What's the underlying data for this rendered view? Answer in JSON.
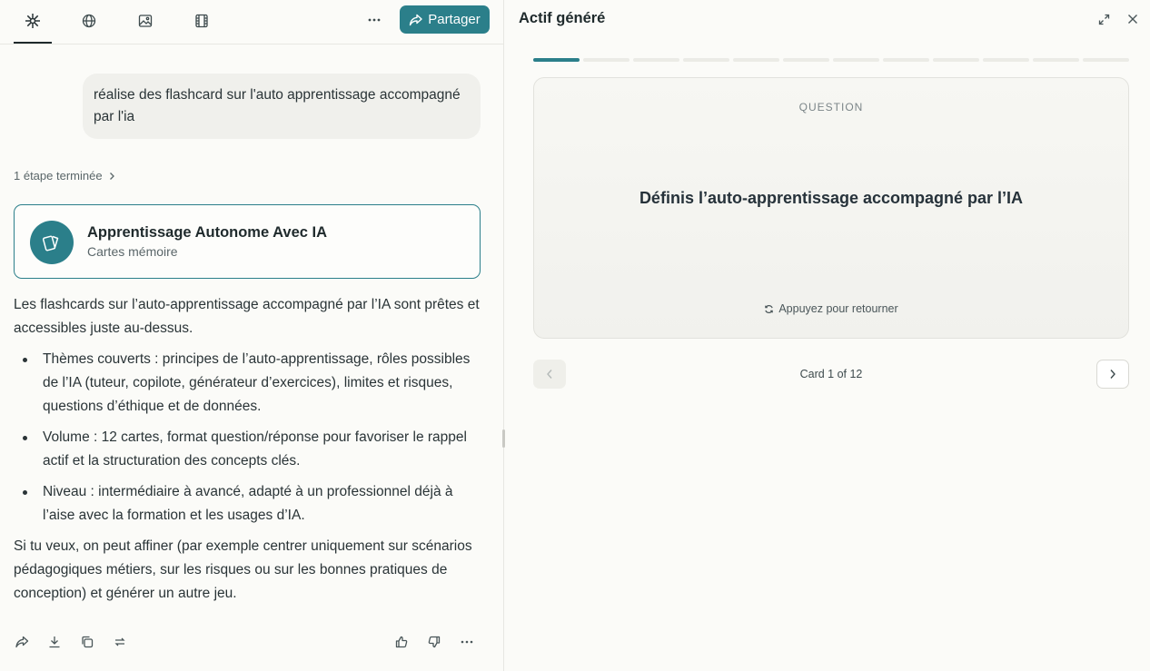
{
  "left_panel": {
    "tabs": [
      {
        "icon": "sparkle-icon",
        "active": true
      },
      {
        "icon": "globe-icon"
      },
      {
        "icon": "image-icon"
      },
      {
        "icon": "film-icon"
      }
    ],
    "share_label": "Partager",
    "user_message": "réalise des flashcard sur l'auto apprentissage accompagné par l'ia",
    "steps_label": "1 étape terminée",
    "asset": {
      "title": "Apprentissage Autonome Avec IA",
      "subtitle": "Cartes mémoire",
      "icon": "cards-icon"
    },
    "answer": {
      "intro": "Les flashcards sur l’auto-apprentissage accompagné par l’IA sont prêtes et accessibles juste au-dessus.",
      "bullets": [
        "Thèmes couverts : principes de l’auto-apprentissage, rôles possibles de l’IA (tuteur, copilote, générateur d’exercices), limites et risques, questions d’éthique et de données.",
        "Volume : 12 cartes, format question/réponse pour favoriser le rappel actif et la structuration des concepts clés.",
        "Niveau : intermédiaire à avancé, adapté à un professionnel déjà à l’aise avec la formation et les usages d’IA."
      ],
      "outro": "Si tu veux, on peut affiner (par exemple centrer uniquement sur scénarios pédagogiques métiers, sur les risques ou sur les bonnes pratiques de conception) et générer un autre jeu."
    },
    "actions_left": [
      "share-icon",
      "download-icon",
      "copy-icon",
      "regenerate-icon"
    ],
    "actions_right": [
      "thumbs-up-icon",
      "thumbs-down-icon",
      "more-icon"
    ]
  },
  "right_panel": {
    "title": "Actif généré",
    "progress": {
      "current": 1,
      "total": 12
    },
    "card": {
      "label": "QUESTION",
      "text": "Définis l’auto-apprentissage accompagné par l’IA",
      "hint": "Appuyez pour retourner"
    },
    "counter": "Card 1 of 12"
  },
  "colors": {
    "accent": "#2b7f8a",
    "background": "#fbfbf8",
    "text": "#1f2a2c"
  }
}
